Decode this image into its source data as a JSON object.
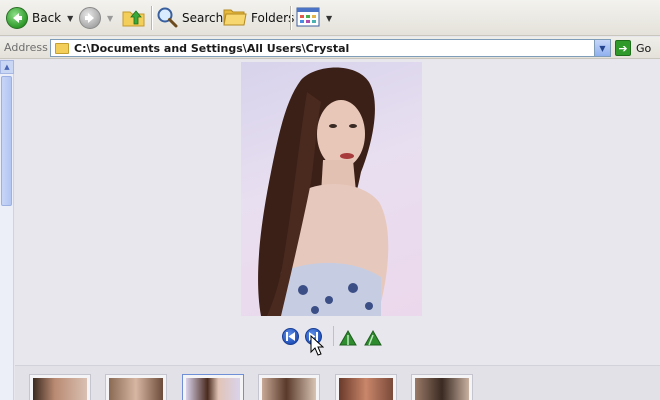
{
  "toolbar": {
    "back_label": "Back",
    "search_label": "Search",
    "folders_label": "Folders",
    "icons": [
      "back-arrow-icon",
      "forward-arrow-icon",
      "folder-up-icon",
      "search-icon",
      "folders-icon",
      "views-icon"
    ]
  },
  "address": {
    "label": "Address",
    "path": "C:\\Documents and Settings\\All Users\\Crystal",
    "go_label": "Go"
  },
  "viewer": {
    "photo_subject": "portrait photo",
    "controls": [
      "previous-image",
      "next-image",
      "rotate-clockwise",
      "rotate-counterclockwise"
    ]
  },
  "filmstrip": {
    "thumbnail_count": 6,
    "selected_index": 2
  },
  "colors": {
    "go_green": "#2f9a2a",
    "nav_blue": "#1f4fb8",
    "rotate_green": "#2e8b2e"
  }
}
